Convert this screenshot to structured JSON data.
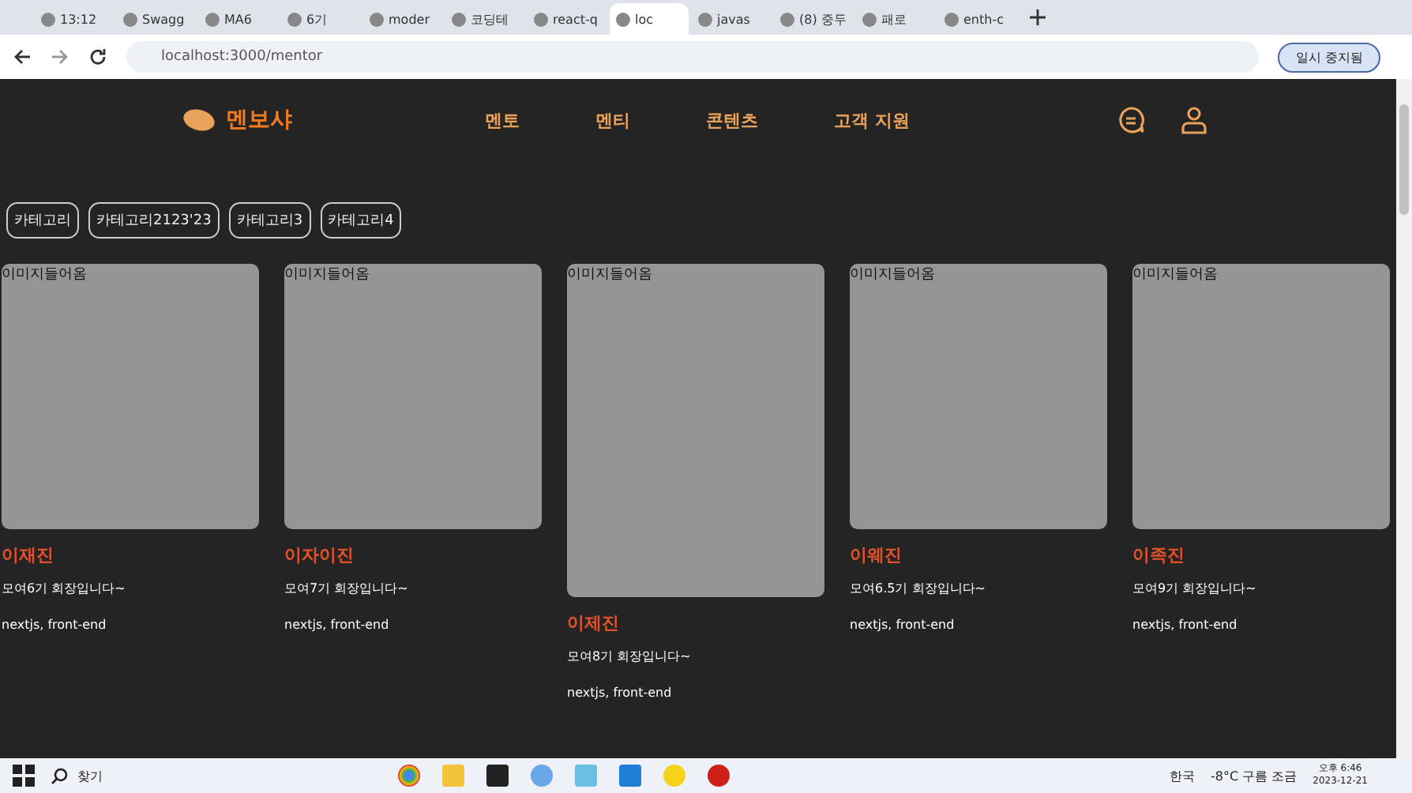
{
  "browser": {
    "tabs": [
      {
        "label": "13:12",
        "selected": false
      },
      {
        "label": "Swagg",
        "selected": false
      },
      {
        "label": "MA6",
        "selected": false
      },
      {
        "label": "6기",
        "selected": false
      },
      {
        "label": "moder",
        "selected": false
      },
      {
        "label": "코딩테",
        "selected": false
      },
      {
        "label": "react-q",
        "selected": false
      },
      {
        "label": "loc",
        "selected": true
      },
      {
        "label": "javas",
        "selected": false
      },
      {
        "label": "(8) 중두",
        "selected": false
      },
      {
        "label": "패로",
        "selected": false
      },
      {
        "label": "enth-c",
        "selected": false
      }
    ],
    "address": "localhost:3000/mentor",
    "profile": "일시 중지됨"
  },
  "site": {
    "logo": "멘보샤",
    "nav": [
      "멘토",
      "멘티",
      "콘텐츠",
      "고객 지원"
    ]
  },
  "categories": [
    "카테고리",
    "카테고리2123'23",
    "카테고리3",
    "카테고리4"
  ],
  "mentors": [
    {
      "image_alt": "이미지들어옴",
      "name": "이재진",
      "description": "모여6기 회장입니다~",
      "tags": "nextjs, front-end",
      "enlarged": false
    },
    {
      "image_alt": "이미지들어옴",
      "name": "이자이진",
      "description": "모여7기 회장입니다~",
      "tags": "nextjs, front-end",
      "enlarged": false
    },
    {
      "image_alt": "이미지들어옴",
      "name": "이제진",
      "description": "모여8기 회장입니다~",
      "tags": "nextjs, front-end",
      "enlarged": true
    },
    {
      "image_alt": "이미지들어옴",
      "name": "이웨진",
      "description": "모여6.5기 회장입니다~",
      "tags": "nextjs, front-end",
      "enlarged": false
    },
    {
      "image_alt": "이미지들어옴",
      "name": "이족진",
      "description": "모여9기 회장입니다~",
      "tags": "nextjs, front-end",
      "enlarged": false
    }
  ],
  "taskbar": {
    "search": "찾기",
    "ime": "한국",
    "weather": "-8°C 구름 조금",
    "time": "오후 6:46",
    "date": "2023-12-21"
  }
}
